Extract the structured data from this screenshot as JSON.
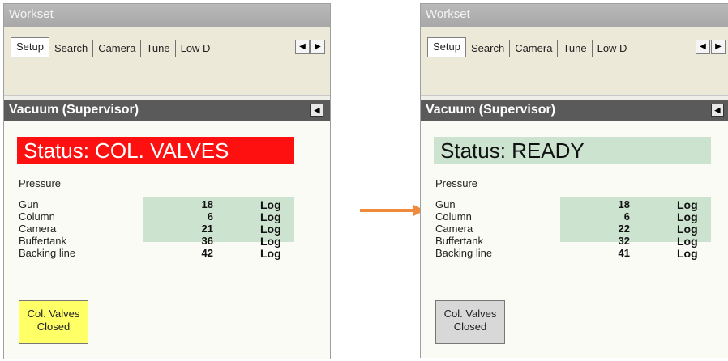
{
  "panels": [
    {
      "workset_title": "Workset",
      "tabs": [
        "Setup",
        "Search",
        "Camera",
        "Tune",
        "Low D"
      ],
      "section_title": "Vacuum (Supervisor)",
      "status_text": "Status:  COL. VALVES",
      "status_color": "#ff1010",
      "pressure_label": "Pressure",
      "rows": [
        {
          "name": "Gun",
          "value": "18",
          "log": "Log"
        },
        {
          "name": "Column",
          "value": "6",
          "log": "Log"
        },
        {
          "name": "Camera",
          "value": "21",
          "log": "Log"
        },
        {
          "name": "Buffertank",
          "value": "36",
          "log": "Log"
        },
        {
          "name": "Backing line",
          "value": "42",
          "log": "Log"
        }
      ],
      "valves_button": {
        "line1": "Col. Valves",
        "line2": "Closed",
        "color": "#ffff66"
      }
    },
    {
      "workset_title": "Workset",
      "tabs": [
        "Setup",
        "Search",
        "Camera",
        "Tune",
        "Low D"
      ],
      "section_title": "Vacuum (Supervisor)",
      "status_text": "Status:  READY",
      "status_color": "#cce3cf",
      "pressure_label": "Pressure",
      "rows": [
        {
          "name": "Gun",
          "value": "18",
          "log": "Log"
        },
        {
          "name": "Column",
          "value": "6",
          "log": "Log"
        },
        {
          "name": "Camera",
          "value": "22",
          "log": "Log"
        },
        {
          "name": "Buffertank",
          "value": "32",
          "log": "Log"
        },
        {
          "name": "Backing line",
          "value": "41",
          "log": "Log"
        }
      ],
      "valves_button": {
        "line1": "Col. Valves",
        "line2": "Closed",
        "color": "#d8d8d8"
      }
    }
  ],
  "arrow": {
    "icon": "arrow-right-icon",
    "color": "#f08a3c"
  }
}
